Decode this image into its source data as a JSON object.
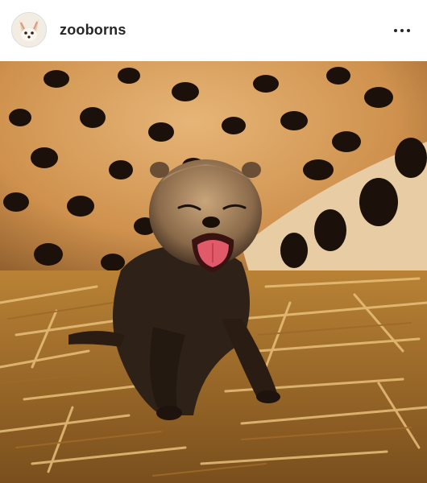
{
  "post": {
    "username": "zooborns",
    "avatar_icon": "fennec-fox-avatar-icon",
    "menu_icon": "more-options-icon",
    "photo_subject": "cheetah-cub-photo"
  },
  "colors": {
    "header_bg": "#ffffff",
    "text": "#262626",
    "fur": "#d9a25f",
    "spot": "#1a0f08",
    "straw": "#c9953f",
    "cub": "#3a2a1f",
    "tongue": "#e05a6a"
  }
}
